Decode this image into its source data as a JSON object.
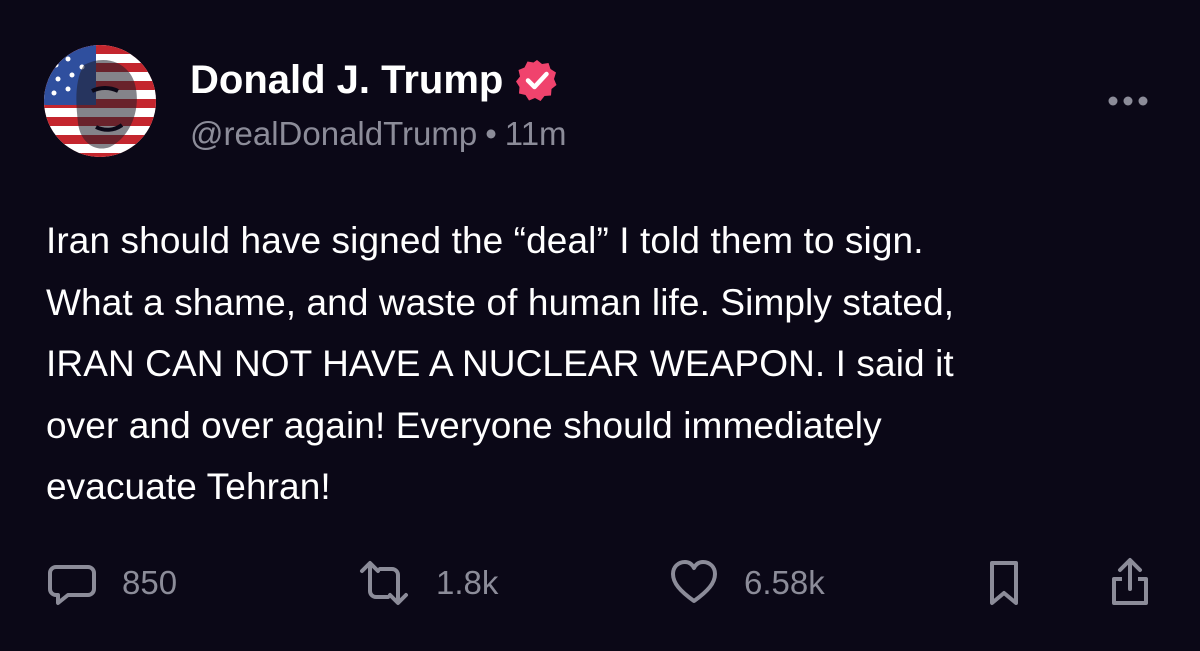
{
  "author": {
    "name": "Donald J. Trump",
    "handle": "@realDonaldTrump",
    "separator": "•",
    "time": "11m",
    "verified": true,
    "verified_color": "#f0436d"
  },
  "post": {
    "lines": [
      "Iran should have signed the “deal” I told them to sign.",
      "What a shame, and waste of human life. Simply stated,",
      "IRAN CAN NOT HAVE A NUCLEAR WEAPON. I said it",
      "over and over again! Everyone should immediately",
      "evacuate Tehran!"
    ]
  },
  "actions": {
    "reply_count": "850",
    "repost_count": "1.8k",
    "like_count": "6.58k"
  },
  "icons": {
    "more": "more-horizontal-icon",
    "reply": "comment-icon",
    "repost": "repost-icon",
    "like": "heart-icon",
    "bookmark": "bookmark-icon",
    "share": "share-icon"
  },
  "colors": {
    "background": "#0b0817",
    "text": "#ffffff",
    "muted": "#8c8c99"
  }
}
